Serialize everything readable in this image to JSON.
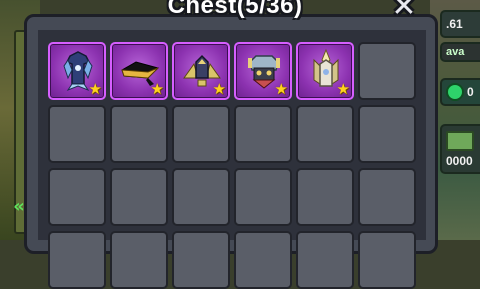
{
  "chest": {
    "title": "Chest(5/36)",
    "close_label": "✕",
    "collapse_label": "«",
    "rarity_icon": "star-icon",
    "slots_visible": 24,
    "items": [
      {
        "name": "blue-wizard-robe",
        "icon": "robe-armor-icon",
        "color": "#7ab0e8",
        "rarity_icon": "star-icon"
      },
      {
        "name": "gold-ninja-headband",
        "icon": "headband-icon",
        "color": "#e6b640",
        "rarity_icon": "star-icon"
      },
      {
        "name": "winged-gold-helmet",
        "icon": "helmet-wings-icon",
        "color": "#d9c56a",
        "rarity_icon": "star-icon"
      },
      {
        "name": "pharaoh-mask",
        "icon": "pharaoh-mask-icon",
        "color": "#9fb7c8",
        "rarity_icon": "star-icon"
      },
      {
        "name": "white-feather-crown",
        "icon": "feather-crown-icon",
        "color": "#e9e4d6",
        "rarity_icon": "star-icon"
      }
    ]
  },
  "sidebar_right": {
    "chip1_text": ".61",
    "chip2_text": "ava",
    "chip3_text": "0",
    "chip4_text": "0000"
  }
}
